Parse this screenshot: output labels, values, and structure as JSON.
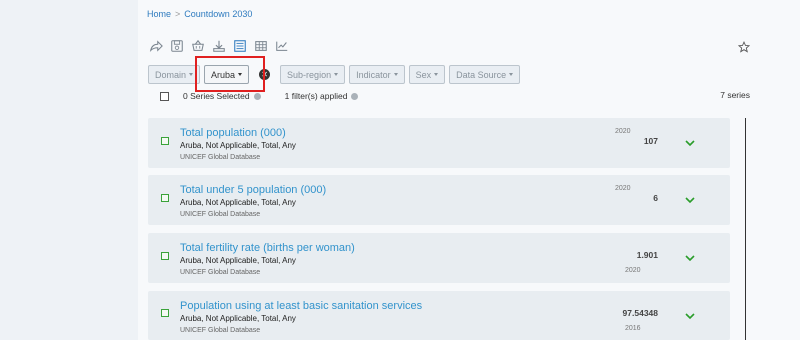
{
  "breadcrumb": {
    "home": "Home",
    "current": "Countdown 2030"
  },
  "toolbar": {
    "icons": [
      "share-icon",
      "save-icon",
      "basket-icon",
      "download-icon",
      "list-view-icon",
      "table-view-icon",
      "chart-view-icon"
    ],
    "favorite_icon": "star-icon"
  },
  "filters": [
    {
      "label": "Domain",
      "active": false
    },
    {
      "label": "Aruba",
      "active": true
    },
    {
      "label": "Sub-region",
      "active": false
    },
    {
      "label": "Indicator",
      "active": false
    },
    {
      "label": "Sex",
      "active": false
    },
    {
      "label": "Data Source",
      "active": false
    }
  ],
  "selection": {
    "selected_text": "0 Series Selected",
    "filters_text": "1 filter(s) applied",
    "series_count": "7 series"
  },
  "series": [
    {
      "title": "Total population (000)",
      "meta": "Aruba, Not Applicable, Total, Any",
      "source": "UNICEF Global Database",
      "year": "2020",
      "value": "107"
    },
    {
      "title": "Total under 5 population (000)",
      "meta": "Aruba, Not Applicable, Total, Any",
      "source": "UNICEF Global Database",
      "year": "2020",
      "value": "6"
    },
    {
      "title": "Total fertility rate (births per woman)",
      "meta": "Aruba, Not Applicable, Total, Any",
      "source": "UNICEF Global Database",
      "year": "2020",
      "value": "1.901"
    },
    {
      "title": "Population using at least basic sanitation services",
      "meta": "Aruba, Not Applicable, Total, Any",
      "source": "UNICEF Global Database",
      "year": "2016",
      "value": "97.54348"
    }
  ],
  "colors": {
    "link": "#3293cc",
    "accent_green": "#3aa33a",
    "highlight": "#e02020"
  }
}
